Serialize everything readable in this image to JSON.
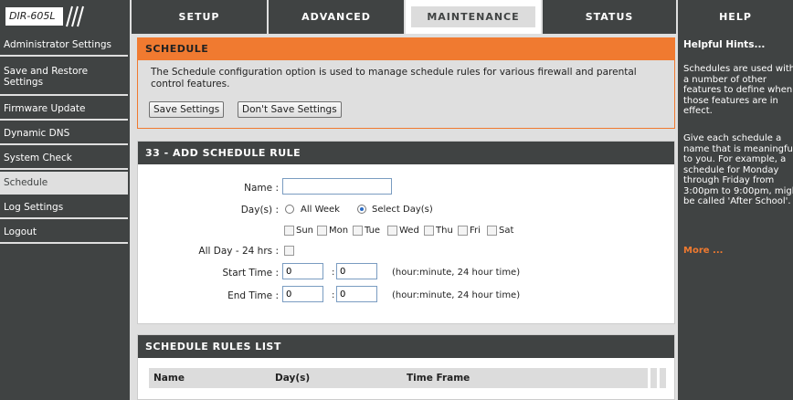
{
  "brand": {
    "model": "DIR-605L"
  },
  "nav": {
    "tabs": [
      "SETUP",
      "ADVANCED",
      "MAINTENANCE",
      "STATUS",
      "HELP"
    ],
    "active_tab": "MAINTENANCE"
  },
  "sidebar": {
    "items": [
      {
        "label": "Administrator Settings"
      },
      {
        "label": "Save and Restore Settings"
      },
      {
        "label": "Firmware Update"
      },
      {
        "label": "Dynamic DNS"
      },
      {
        "label": "System Check"
      },
      {
        "label": "Schedule"
      },
      {
        "label": "Log Settings"
      },
      {
        "label": "Logout"
      }
    ],
    "active_item": "Schedule"
  },
  "schedule": {
    "heading": "SCHEDULE",
    "description_line1": "The Schedule configuration option is used to manage schedule rules for various firewall and parental",
    "description_line2": "control features.",
    "save_label": "Save Settings",
    "dont_save_label": "Don't Save Settings"
  },
  "add_rule": {
    "heading": "33 - ADD SCHEDULE RULE",
    "name_label": "Name :",
    "name_value": "",
    "days_label": "Day(s) :",
    "all_week_label": "All Week",
    "select_days_label": "Select Day(s)",
    "day_mode": "Select Day(s)",
    "days": [
      "Sun",
      "Mon",
      "Tue",
      "Wed",
      "Thu",
      "Fri",
      "Sat"
    ],
    "all_day_label": "All Day - 24 hrs :",
    "start_time_label": "Start Time :",
    "start_hour": "0",
    "start_minute": "0",
    "end_time_label": "End Time :",
    "end_hour": "0",
    "end_minute": "0",
    "time_colon": ":",
    "time_hint": "(hour:minute, 24 hour time)"
  },
  "rules_list": {
    "heading": "SCHEDULE RULES LIST",
    "columns": [
      "Name",
      "Day(s)",
      "Time Frame"
    ]
  },
  "help": {
    "title": "Helpful Hints...",
    "para1": [
      "Schedules are used with",
      "a number of other",
      "features to define when",
      "those features are in",
      "effect."
    ],
    "para2": [
      "Give each schedule a",
      "name that is meaningful",
      "to you. For example, a",
      "schedule for Monday",
      "through Friday from",
      "3:00pm to 9:00pm, might",
      "be called 'After School'."
    ],
    "more_label": "More ..."
  },
  "colors": {
    "header_bg": "#404343",
    "accent_orange": "#f07a30",
    "page_bg": "#dfdfdf"
  }
}
